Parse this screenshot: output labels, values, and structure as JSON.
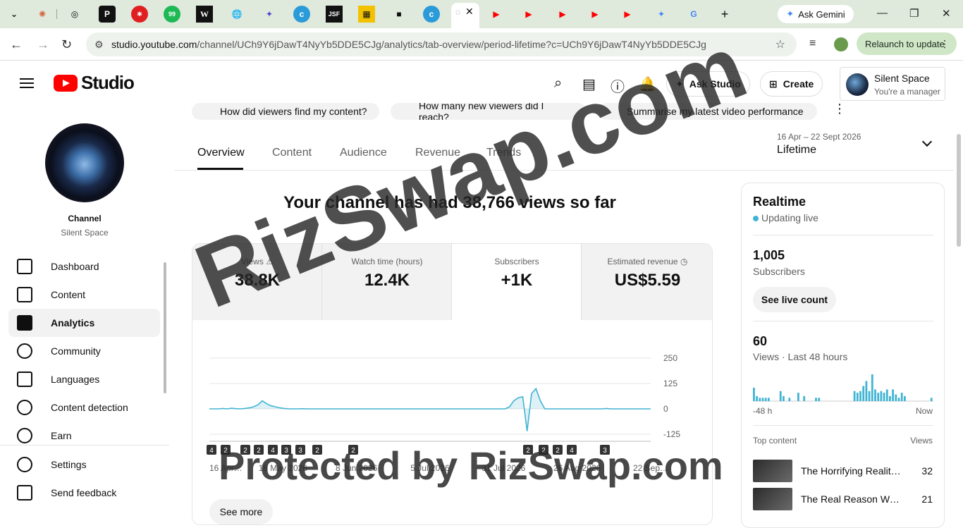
{
  "browser": {
    "ask_gemini": "Ask Gemini",
    "url_host": "studio.youtube.com",
    "url_path": "/channel/UCh9Y6jDawT4NyYb5DDE5CJg/analytics/tab-overview/period-lifetime?c=UCh9Y6jDawT4NyYb5DDE5CJg",
    "relaunch": "Relaunch to update"
  },
  "header": {
    "logo_text": "Studio",
    "ask_studio": "Ask Studio",
    "create": "Create",
    "account_name": "Silent Space",
    "account_role": "You're a manager"
  },
  "sidebar": {
    "channel_heading": "Channel",
    "channel_name": "Silent Space",
    "items": [
      {
        "label": "Dashboard"
      },
      {
        "label": "Content"
      },
      {
        "label": "Analytics"
      },
      {
        "label": "Community"
      },
      {
        "label": "Languages"
      },
      {
        "label": "Content detection"
      },
      {
        "label": "Earn"
      },
      {
        "label": "Settings"
      },
      {
        "label": "Send feedback"
      }
    ]
  },
  "suggestions": [
    "How did viewers find my content?",
    "How many new viewers did I reach?",
    "Summarise my latest video performance"
  ],
  "tabs": [
    "Overview",
    "Content",
    "Audience",
    "Revenue",
    "Trends"
  ],
  "period": {
    "range": "16 Apr – 22 Sept 2026",
    "value": "Lifetime"
  },
  "headline": "Your channel has had 38,766 views so far",
  "metrics": [
    {
      "label": "Views",
      "value": "38.8K"
    },
    {
      "label": "Watch time (hours)",
      "value": "12.4K"
    },
    {
      "label": "Subscribers",
      "value": "+1K"
    },
    {
      "label": "Estimated revenue",
      "value": "US$5.59"
    }
  ],
  "chart_data": {
    "type": "line",
    "y_ticks": [
      "250",
      "125",
      "0",
      "-125"
    ],
    "ylim": [
      -125,
      250
    ],
    "x_ticks": [
      "16 Apr…",
      "18 May 2026",
      "8 Jun 2026",
      "5 Jul 2026",
      "31 Jul 2026",
      "26 Aug 2026",
      "22 Sep…"
    ],
    "series": [
      {
        "values": [
          0,
          0,
          0,
          2,
          0,
          3,
          1,
          0,
          2,
          5,
          10,
          20,
          40,
          25,
          15,
          10,
          5,
          2,
          0,
          0,
          0,
          1,
          0,
          0,
          0,
          0,
          0,
          0,
          0,
          0,
          0,
          0,
          0,
          0,
          0,
          0,
          0,
          0,
          0,
          0,
          0,
          0,
          0,
          0,
          0,
          0,
          0,
          0,
          0,
          0,
          0,
          0,
          0,
          0,
          0,
          0,
          0,
          0,
          0,
          0,
          0,
          0,
          0,
          0,
          0,
          0,
          0,
          0,
          10,
          40,
          55,
          60,
          -110,
          75,
          100,
          40,
          0,
          0,
          0,
          0,
          0,
          0,
          0,
          0,
          0,
          0,
          0,
          0,
          0,
          0,
          2,
          0,
          0,
          0,
          0,
          0,
          0,
          0,
          0,
          0,
          0
        ]
      }
    ],
    "markers": [
      "4",
      "2",
      "2",
      "2",
      "4",
      "3",
      "3",
      "2",
      "2",
      "2",
      "2",
      "2",
      "4",
      "4",
      "3"
    ]
  },
  "see_more": "See more",
  "realtime": {
    "title": "Realtime",
    "status": "Updating live",
    "subscribers": "1,005",
    "subscribers_label": "Subscribers",
    "see_live_count": "See live count",
    "views": "60",
    "views_label": "Views · Last 48 hours",
    "x_start": "-48 h",
    "x_end": "Now",
    "top_content_label": "Top content",
    "views_col": "Views",
    "top": [
      {
        "title": "The Horrifying Reality …",
        "views": "32"
      },
      {
        "title": "The Real Reason We …",
        "views": "21"
      }
    ],
    "bars": [
      8,
      3,
      2,
      2,
      2,
      2,
      0,
      0,
      0,
      6,
      3,
      0,
      2,
      0,
      0,
      5,
      0,
      3,
      0,
      0,
      0,
      2,
      2,
      0,
      0,
      0,
      0,
      0,
      0,
      0,
      0,
      0,
      0,
      0,
      6,
      5,
      6,
      9,
      12,
      6,
      16,
      7,
      5,
      6,
      5,
      7,
      3,
      7,
      4,
      2,
      5,
      3,
      0,
      0,
      0,
      0,
      0,
      0,
      0,
      0,
      2
    ]
  },
  "watermark": "RizSwap.com",
  "watermark_footer": "Protected by RizSwap.com"
}
